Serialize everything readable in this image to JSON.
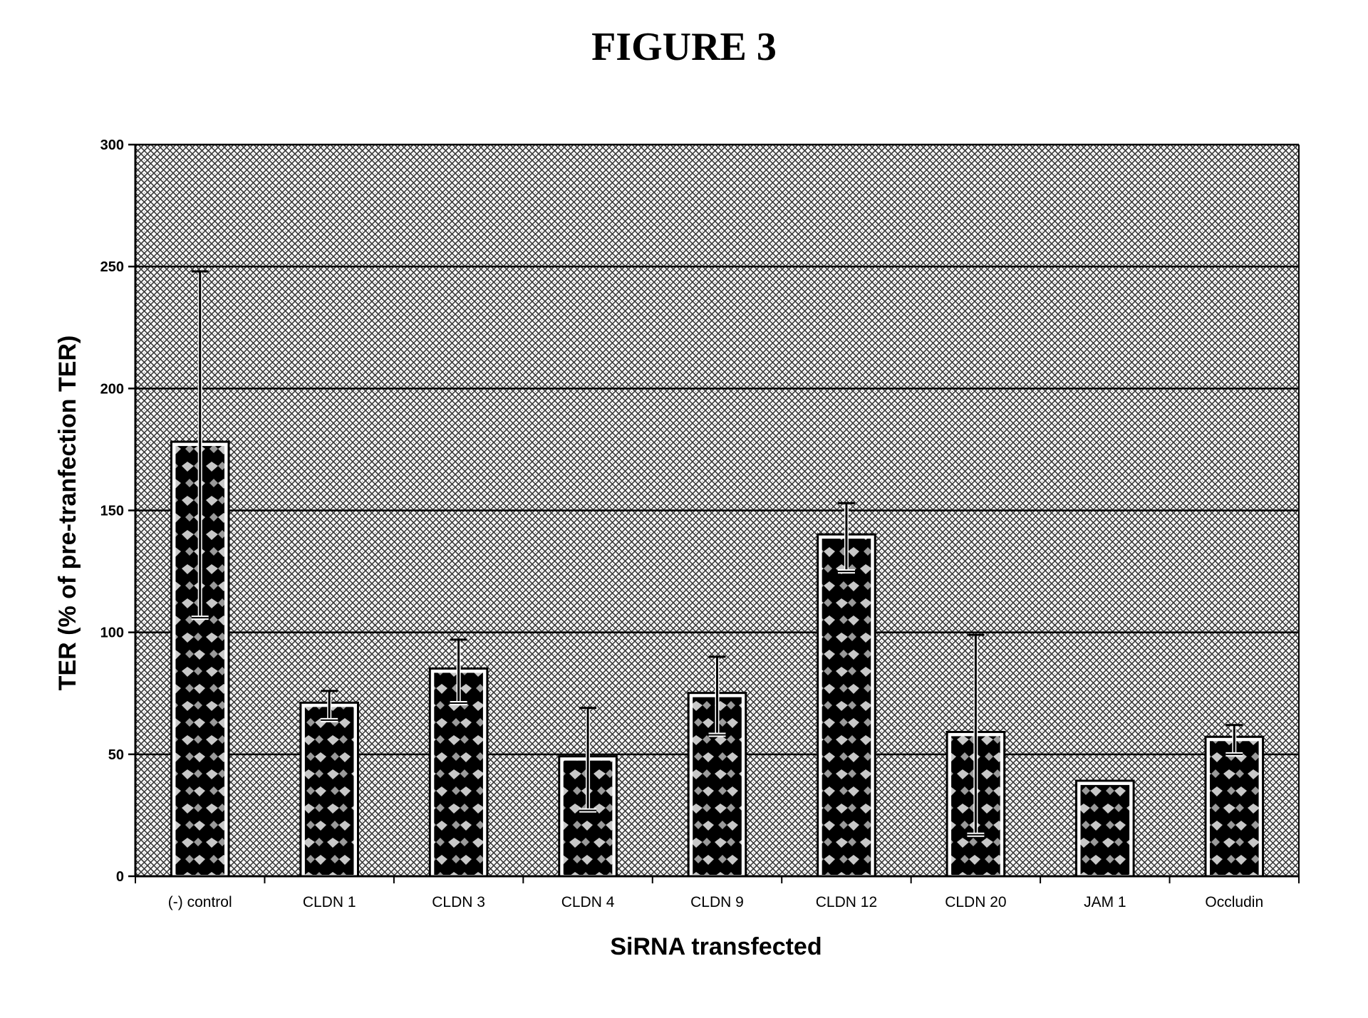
{
  "figure": {
    "title": "FIGURE 3"
  },
  "chart_data": {
    "type": "bar",
    "title": "FIGURE 3",
    "xlabel": "SiRNA transfected",
    "ylabel": "TER (% of pre-tranfection TER)",
    "ylim": [
      0,
      300
    ],
    "yticks": [
      0,
      50,
      100,
      150,
      200,
      250,
      300
    ],
    "grid": true,
    "legend": "none",
    "categories": [
      "(-) control",
      "CLDN 1",
      "CLDN 3",
      "CLDN 4",
      "CLDN 9",
      "CLDN 12",
      "CLDN 20",
      "JAM 1",
      "Occludin"
    ],
    "values": [
      177,
      70,
      84,
      48,
      74,
      139,
      58,
      38,
      56
    ],
    "error": [
      71,
      6,
      13,
      21,
      16,
      14,
      41,
      0,
      6
    ],
    "colors": {
      "bar_dark": "#000000",
      "bar_light": "#bdbdbd",
      "background_hatch": "#4a4a4a",
      "background": "#ffffff",
      "outline": "#000000"
    }
  }
}
